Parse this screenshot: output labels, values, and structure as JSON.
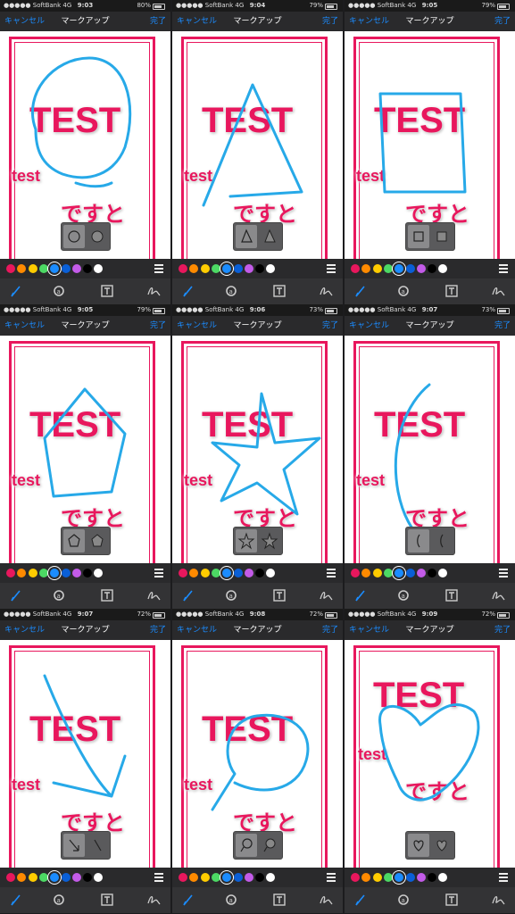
{
  "app": {
    "carrier": "●●●●● SoftBank  4G",
    "cancel": "キャンセル",
    "title": "マークアップ",
    "done": "完了",
    "canvas_texts": {
      "big": "TEST",
      "small": "test",
      "japanese": "ですと"
    },
    "colors": [
      "#e8175d",
      "#ff8a00",
      "#ffcc00",
      "#4cd964",
      "#1b8cff",
      "#0a5fd6",
      "#c35be8",
      "#000000",
      "#ffffff"
    ],
    "selected_color": "#1b8cff",
    "stroke_color": "#27a9e8",
    "toolbar": [
      "pen-icon",
      "loupe-icon",
      "text-icon",
      "signature-icon"
    ]
  },
  "panels": [
    {
      "time": "9:03",
      "battery": "80%",
      "shape": "circle"
    },
    {
      "time": "9:04",
      "battery": "79%",
      "shape": "triangle"
    },
    {
      "time": "9:05",
      "battery": "79%",
      "shape": "square"
    },
    {
      "time": "9:05",
      "battery": "79%",
      "shape": "pentagon"
    },
    {
      "time": "9:06",
      "battery": "73%",
      "shape": "star"
    },
    {
      "time": "9:07",
      "battery": "73%",
      "shape": "line"
    },
    {
      "time": "9:07",
      "battery": "72%",
      "shape": "arrow"
    },
    {
      "time": "9:08",
      "battery": "72%",
      "shape": "speech-bubble"
    },
    {
      "time": "9:09",
      "battery": "72%",
      "shape": "heart"
    }
  ]
}
